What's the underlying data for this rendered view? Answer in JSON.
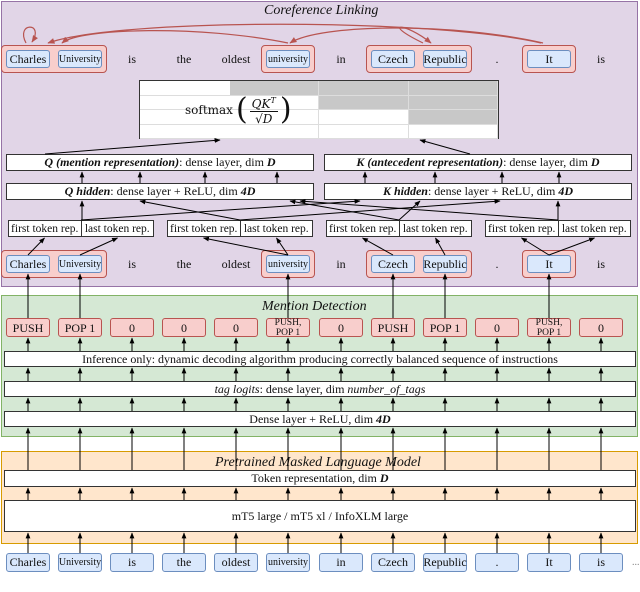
{
  "tokens": [
    "Charles",
    "University",
    "is",
    "the",
    "oldest",
    "university",
    "in",
    "Czech",
    "Republic",
    ".",
    "It",
    "is"
  ],
  "ellipsis": "...",
  "panels": {
    "coref_title": "Coreference Linking",
    "mention_title": "Mention Detection",
    "plm_title": "Pretrained Masked Language Model"
  },
  "coreference": {
    "mentions": [
      {
        "span": [
          0,
          1
        ],
        "tokens": [
          "Charles",
          "University"
        ]
      },
      {
        "span": [
          5,
          5
        ],
        "tokens": [
          "university"
        ]
      },
      {
        "span": [
          7,
          8
        ],
        "tokens": [
          "Czech",
          "Republic"
        ]
      },
      {
        "span": [
          10,
          10
        ],
        "tokens": [
          "It"
        ]
      }
    ],
    "links": [
      {
        "from": "Charles University",
        "to": "Charles University",
        "type": "self"
      },
      {
        "from": "university",
        "to": "Charles University"
      },
      {
        "from": "Czech Republic",
        "to": "Czech Republic",
        "type": "self"
      },
      {
        "from": "It",
        "to": "Charles University"
      },
      {
        "from": "It",
        "to": "university"
      }
    ],
    "softmax_label": "softmax",
    "softmax_formula": {
      "numerator_base": "QK",
      "numerator_sup": "T",
      "denominator": "√D"
    },
    "q_output": {
      "italic": "Q (mention representation)",
      "rest": ": dense layer, dim ",
      "dim": "D"
    },
    "k_output": {
      "italic": "K (antecedent representation)",
      "rest": ": dense layer, dim ",
      "dim": "D"
    },
    "q_hidden": {
      "italic": "Q hidden",
      "rest": ": dense layer + ReLU, dim ",
      "dim": "4D"
    },
    "k_hidden": {
      "italic": "K hidden",
      "rest": ": dense layer + ReLU, dim ",
      "dim": "4D"
    },
    "first_token_rep": "first token rep.",
    "last_token_rep": "last token rep."
  },
  "mention_detection": {
    "tags": [
      "PUSH",
      "POP 1",
      "0",
      "0",
      "0",
      "PUSH, POP 1",
      "0",
      "PUSH",
      "POP 1",
      "0",
      "PUSH, POP 1",
      "0"
    ],
    "inference_bar": "Inference only: dynamic decoding algorithm producing correctly balanced sequence of instructions",
    "tag_logits": {
      "italic": "tag logits",
      "rest": ": dense layer, dim ",
      "dim_italic": "number_of_tags"
    },
    "dense_relu": {
      "text": "Dense layer + ReLU, dim ",
      "dim": "4D"
    }
  },
  "plm": {
    "token_rep": {
      "text": "Token representation, dim ",
      "dim": "D"
    },
    "models": "mT5 large / mT5 xl / InfoXLM large"
  },
  "colors": {
    "coref_panel": "#e1d5e7",
    "mention_panel": "#d5e8d4",
    "plm_panel": "#ffe6cc",
    "token_fill": "#dae8fc",
    "mention_fill": "#f8cecc",
    "link_arrow": "#b85450"
  }
}
